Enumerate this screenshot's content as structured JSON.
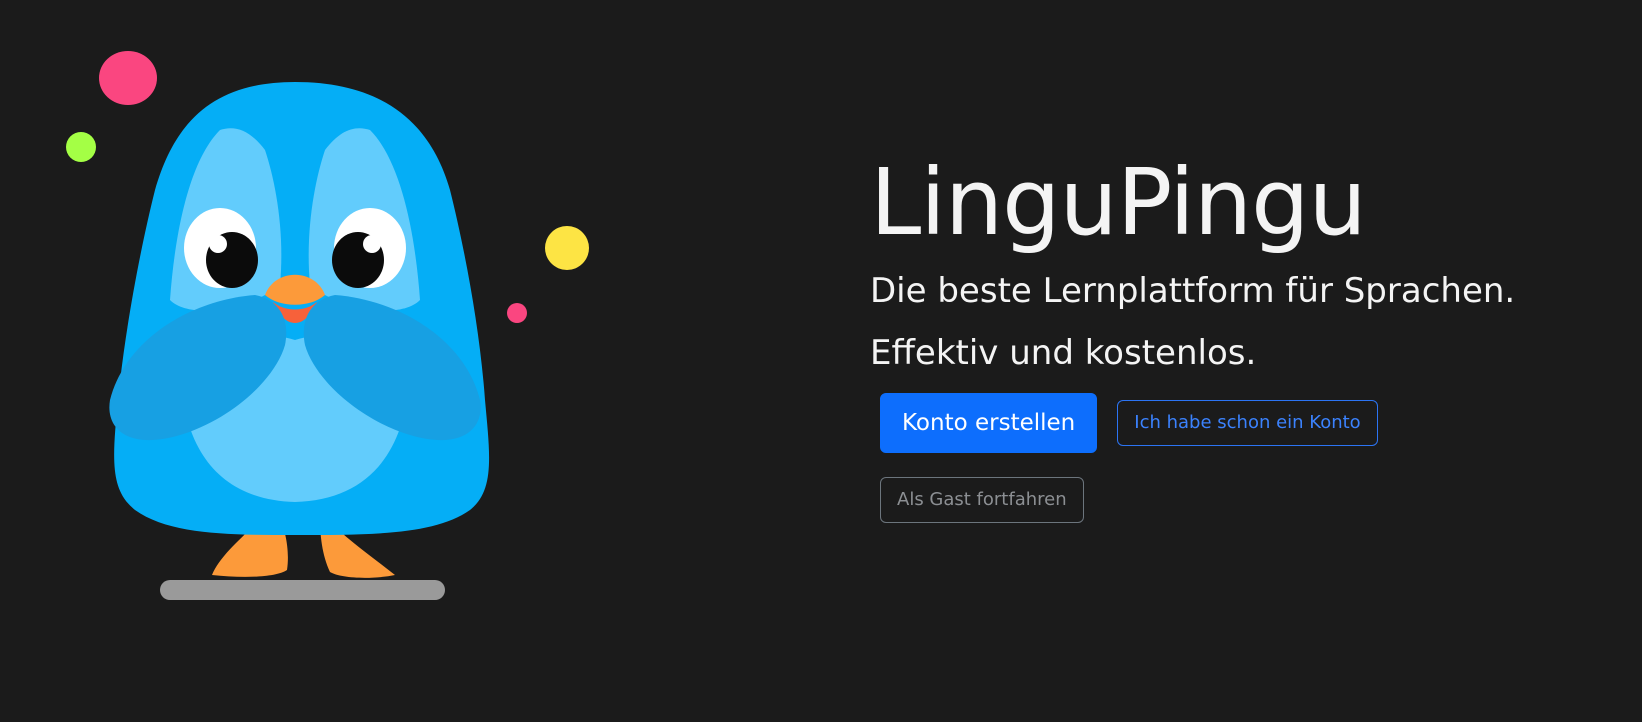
{
  "app": {
    "title": "LinguPingu",
    "tagline": "Die beste Lernplattform für Sprachen.",
    "subtagline": "Effektiv und kostenlos."
  },
  "actions": {
    "create_account": "Konto erstellen",
    "have_account": "Ich habe schon ein Konto",
    "continue_guest": "Als Gast fortfahren"
  },
  "colors": {
    "background": "#1b1b1b",
    "primary": "#0d6efd",
    "secondary": "#6c757d",
    "penguin_body": "#05aef6",
    "penguin_light": "#62ccfc",
    "penguin_wing": "#17a0e3",
    "beak": "#fc9a3a",
    "confetti_pink": "#fa4680",
    "confetti_green": "#a4ff45",
    "confetti_yellow": "#fde444"
  },
  "illustration": {
    "name": "penguin-mascot"
  }
}
